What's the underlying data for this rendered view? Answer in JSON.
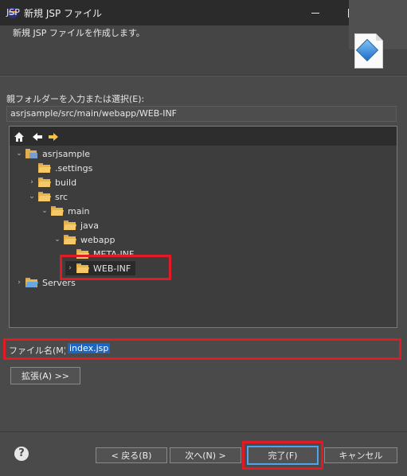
{
  "window": {
    "title": "新規 JSP ファイル",
    "min_glyph": "—",
    "max_glyph": "☐",
    "close_glyph": "✕"
  },
  "header": {
    "title": "JSP",
    "description": "新規 JSP ファイルを作成します。",
    "banner_icon": "jsp-wizard-icon"
  },
  "parent_folder": {
    "label": "親フォルダーを入力または選択(E):",
    "value": "asrjsample/src/main/webapp/WEB-INF"
  },
  "tree": {
    "toolbar_icons": [
      "home-icon",
      "back-arrow-icon",
      "forward-arrow-icon"
    ],
    "items": [
      {
        "label": "asrjsample",
        "toggle": "⌄",
        "icon": "project-icon"
      },
      {
        "label": ".settings",
        "toggle": "",
        "icon": "folder-icon"
      },
      {
        "label": "build",
        "toggle": "›",
        "icon": "folder-icon"
      },
      {
        "label": "src",
        "toggle": "⌄",
        "icon": "folder-icon"
      },
      {
        "label": "main",
        "toggle": "⌄",
        "icon": "folder-icon"
      },
      {
        "label": "java",
        "toggle": "",
        "icon": "folder-icon"
      },
      {
        "label": "webapp",
        "toggle": "⌄",
        "icon": "folder-icon"
      },
      {
        "label": "META-INF",
        "toggle": "",
        "icon": "folder-icon"
      },
      {
        "label": "WEB-INF",
        "toggle": "›",
        "icon": "folder-icon",
        "selected": true
      },
      {
        "label": "Servers",
        "toggle": "›",
        "icon": "folder-icon"
      }
    ]
  },
  "filename": {
    "label": "ファイル名(M):",
    "value": "index.jsp"
  },
  "buttons": {
    "advanced": "拡張(A) >>",
    "back": "< 戻る(B)",
    "next": "次へ(N) >",
    "finish": "完了(F)",
    "cancel": "キャンセル",
    "help_glyph": "?"
  },
  "colors": {
    "highlight_box": "#e01b24",
    "selection": "#1a66c2",
    "default_button_border": "#4ea4f0"
  }
}
